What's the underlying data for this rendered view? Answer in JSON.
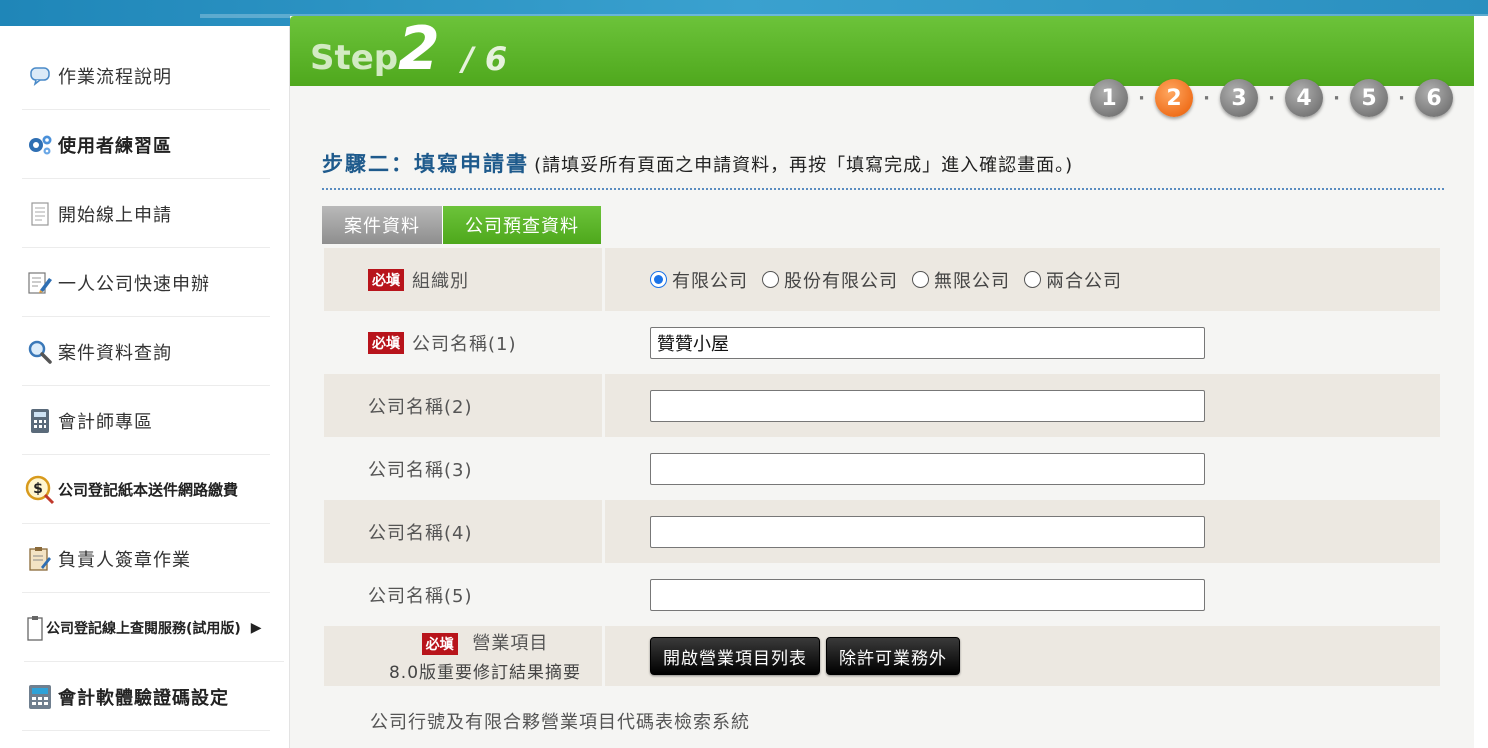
{
  "sidebar": {
    "items": [
      {
        "label": "作業流程說明",
        "icon": "chat-bubble-icon"
      },
      {
        "label": "使用者練習區",
        "icon": "gears-icon"
      },
      {
        "label": "開始線上申請",
        "icon": "document-icon"
      },
      {
        "label": "一人公司快速申辦",
        "icon": "edit-document-icon"
      },
      {
        "label": "案件資料查詢",
        "icon": "magnifier-icon"
      },
      {
        "label": "會計師專區",
        "icon": "calculator-icon"
      },
      {
        "label": "公司登記紙本送件網路繳費",
        "icon": "dollar-payment-icon"
      },
      {
        "label": "負責人簽章作業",
        "icon": "clipboard-sign-icon"
      },
      {
        "label": "公司登記線上查閱服務(試用版)",
        "icon": "clipboard-icon"
      },
      {
        "label": "會計軟體驗證碼設定",
        "icon": "accounting-software-icon"
      }
    ]
  },
  "step": {
    "word": "Step",
    "current": "2",
    "total": "/ 6",
    "pages": [
      "1",
      "2",
      "3",
      "4",
      "5",
      "6"
    ],
    "active_index": 1,
    "separator": "·"
  },
  "heading": {
    "title": "步驟二：填寫申請書",
    "subtitle": "(請填妥所有頁面之申請資料，再按「填寫完成」進入確認畫面。)"
  },
  "tabs": [
    {
      "label": "案件資料",
      "active": false
    },
    {
      "label": "公司預查資料",
      "active": true
    }
  ],
  "form": {
    "required_badge": "必塡",
    "org_type": {
      "label": "組織別",
      "options": [
        "有限公司",
        "股份有限公司",
        "無限公司",
        "兩合公司"
      ],
      "selected": "有限公司"
    },
    "names": [
      {
        "label": "公司名稱(1)",
        "value": "贊贊小屋",
        "required": true
      },
      {
        "label": "公司名稱(2)",
        "value": "",
        "required": false
      },
      {
        "label": "公司名稱(3)",
        "value": "",
        "required": false
      },
      {
        "label": "公司名稱(4)",
        "value": "",
        "required": false
      },
      {
        "label": "公司名稱(5)",
        "value": "",
        "required": false
      }
    ],
    "business": {
      "label": "營業項目",
      "note": "8.0版重要修訂結果摘要",
      "open_list_button": "開啟營業項目列表",
      "exclude_button": "除許可業務外"
    },
    "footnote": "公司行號及有限合夥營業項目代碼表檢索系統"
  },
  "colors": {
    "green": "#5cb52a",
    "active_step": "#f0711e",
    "title_blue": "#1e5a8c",
    "required_red": "#b8141b"
  }
}
